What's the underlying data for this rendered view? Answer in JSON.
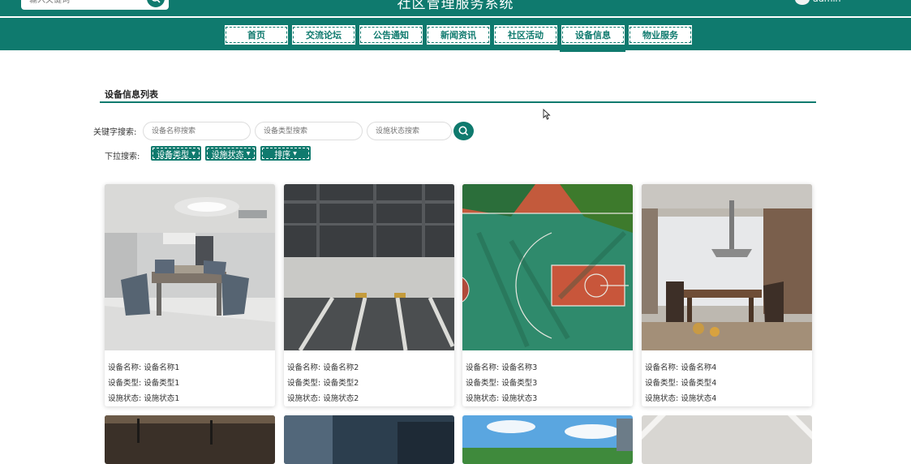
{
  "header": {
    "search_placeholder": "输入关键词",
    "site_title": "社区管理服务系统",
    "user_name": "admin"
  },
  "nav": {
    "items": [
      {
        "label": "首页"
      },
      {
        "label": "交流论坛"
      },
      {
        "label": "公告通知"
      },
      {
        "label": "新闻资讯"
      },
      {
        "label": "社区活动"
      },
      {
        "label": "设备信息"
      },
      {
        "label": "物业服务"
      }
    ],
    "active": "设备信息"
  },
  "section": {
    "title": "设备信息列表"
  },
  "search": {
    "label": "关键字搜索:",
    "name_placeholder": "设备名称搜索",
    "type_placeholder": "设备类型搜索",
    "status_placeholder": "设施状态搜索"
  },
  "dropdowns": {
    "label": "下拉搜索:",
    "type": "设备类型",
    "status": "设施状态",
    "sort": "排序"
  },
  "cards": [
    {
      "name_label": "设备名称:",
      "name": "设备名称1",
      "type_label": "设备类型:",
      "type": "设备类型1",
      "status_label": "设施状态:",
      "status": "设施状态1"
    },
    {
      "name_label": "设备名称:",
      "name": "设备名称2",
      "type_label": "设备类型:",
      "type": "设备类型2",
      "status_label": "设施状态:",
      "status": "设施状态2"
    },
    {
      "name_label": "设备名称:",
      "name": "设备名称3",
      "type_label": "设备类型:",
      "type": "设备类型3",
      "status_label": "设施状态:",
      "status": "设施状态3"
    },
    {
      "name_label": "设备名称:",
      "name": "设备名称4",
      "type_label": "设备类型:",
      "type": "设备类型4",
      "status_label": "设施状态:",
      "status": "设施状态4"
    }
  ],
  "colors": {
    "primary": "#0f7a6e"
  }
}
